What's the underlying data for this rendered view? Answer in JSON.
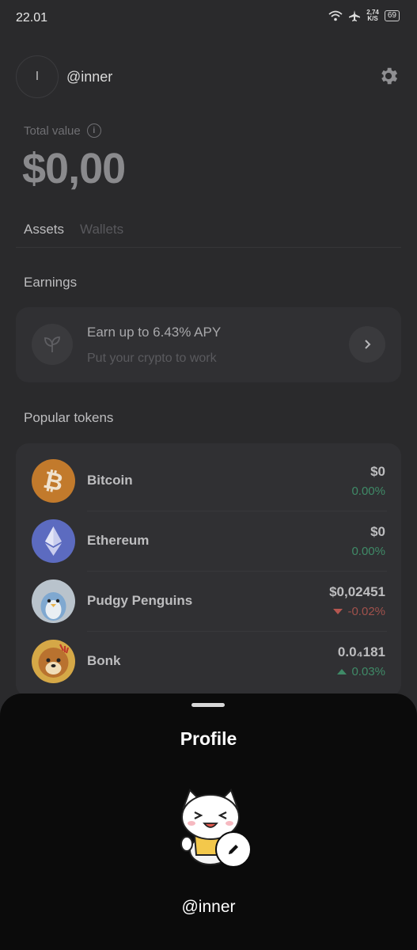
{
  "status": {
    "time": "22.01",
    "speed_value": "2,74",
    "speed_unit": "K/S",
    "battery": "69"
  },
  "header": {
    "avatar_initial": "I",
    "username": "@inner"
  },
  "total": {
    "label": "Total value",
    "value": "$0,00"
  },
  "tabs": [
    {
      "label": "Assets",
      "active": true
    },
    {
      "label": "Wallets",
      "active": false
    }
  ],
  "earnings": {
    "title": "Earnings",
    "card_title": "Earn up to 6.43% APY",
    "card_subtitle": "Put your crypto to work"
  },
  "popular": {
    "title": "Popular tokens",
    "tokens": [
      {
        "name": "Bitcoin",
        "price": "$0",
        "change": "0.00%",
        "direction": "none",
        "icon": "bitcoin-icon"
      },
      {
        "name": "Ethereum",
        "price": "$0",
        "change": "0.00%",
        "direction": "none",
        "icon": "ethereum-icon"
      },
      {
        "name": "Pudgy Penguins",
        "price": "$0,02451",
        "change": "-0.02%",
        "direction": "down",
        "icon": "pudgy-penguins-icon"
      },
      {
        "name": "Bonk",
        "price": "0.0₄181",
        "change": "0.03%",
        "direction": "up",
        "icon": "bonk-icon"
      }
    ]
  },
  "sheet": {
    "title": "Profile",
    "username": "@inner"
  },
  "colors": {
    "positive": "#3f8a67",
    "negative": "#a0514c",
    "bitcoin": "#c27a2c",
    "ethereum": "#5c6bc0"
  }
}
